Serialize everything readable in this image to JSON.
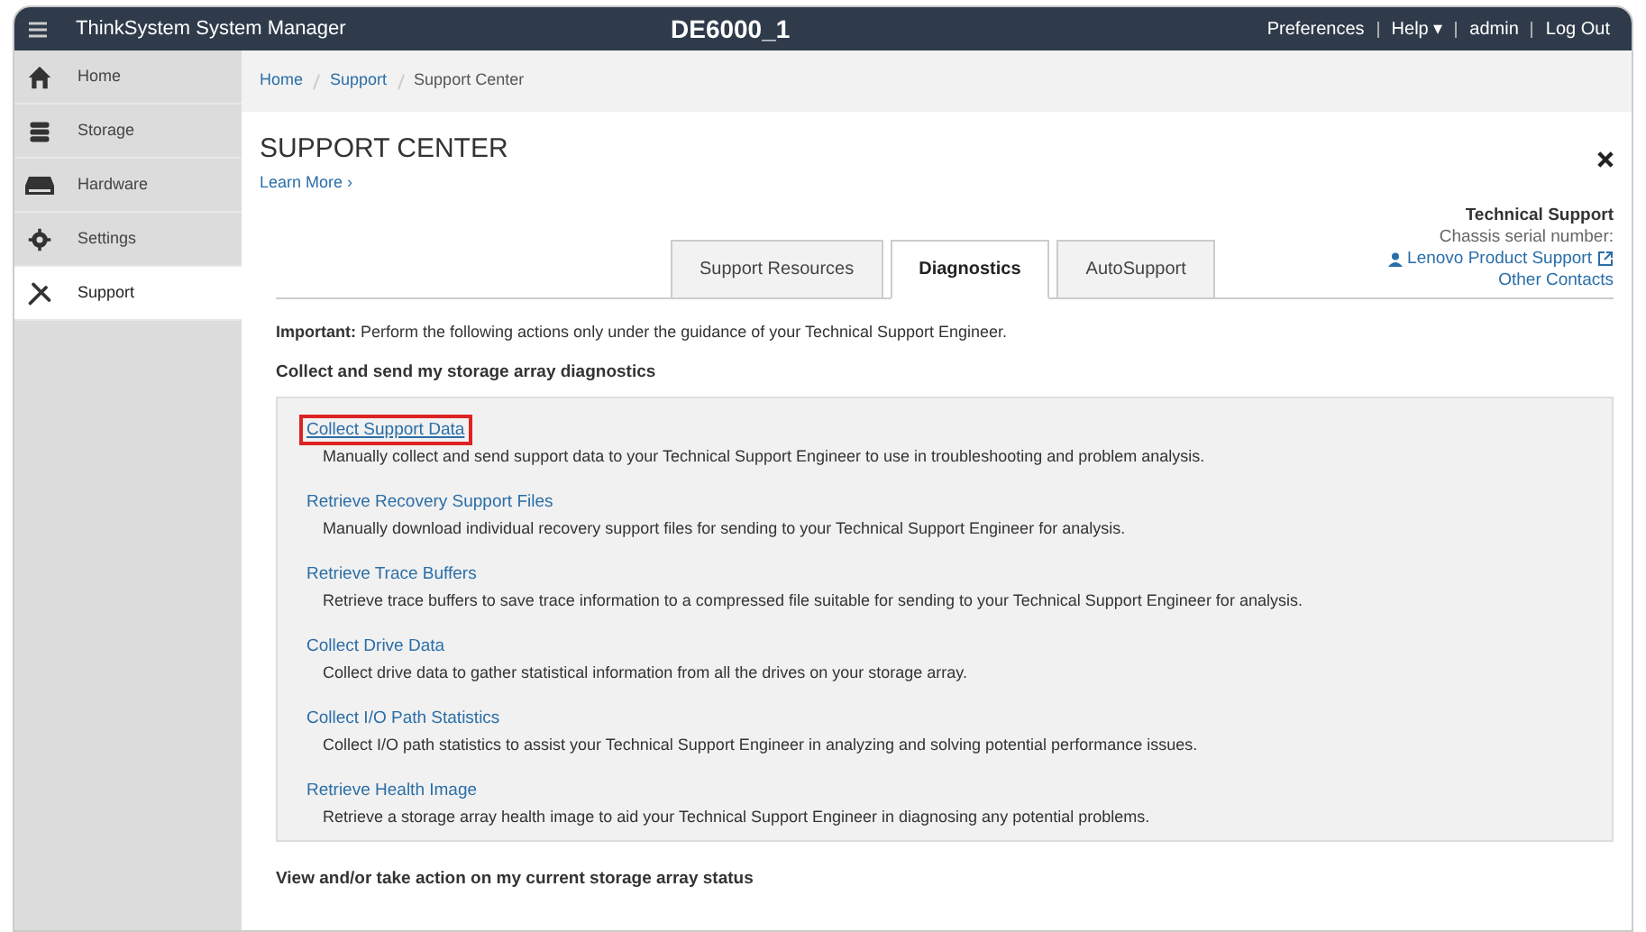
{
  "header": {
    "app_name": "ThinkSystem System Manager",
    "system_name": "DE6000_1",
    "links": [
      "Preferences",
      "Help ▾",
      "admin",
      "Log Out"
    ]
  },
  "sidebar": {
    "items": [
      {
        "label": "Home",
        "selected": false
      },
      {
        "label": "Storage",
        "selected": false
      },
      {
        "label": "Hardware",
        "selected": false
      },
      {
        "label": "Settings",
        "selected": false
      },
      {
        "label": "Support",
        "selected": true
      }
    ]
  },
  "breadcrumb": [
    "Home",
    "Support",
    "Support Center"
  ],
  "page": {
    "title": "SUPPORT CENTER",
    "learn_more": "Learn More ›"
  },
  "technical_support": {
    "heading": "Technical Support",
    "serial_label": "Chassis serial number:",
    "links": [
      "Lenovo Product Support",
      "Other Contacts"
    ]
  },
  "tabs": [
    {
      "label": "Support Resources",
      "selected": false
    },
    {
      "label": "Diagnostics",
      "selected": true
    },
    {
      "label": "AutoSupport",
      "selected": false
    }
  ],
  "important": "**Important:** Perform the following actions only under the guidance of your Technical Support Engineer.",
  "section_heading": "Collect and send my storage array diagnostics",
  "actions": [
    {
      "title": "Collect Support Data",
      "description": "Manually collect and send support data to your Technical Support Engineer to use in troubleshooting and problem analysis.",
      "highlighted": true
    },
    {
      "title": "Retrieve Recovery Support Files",
      "description": "Manually download individual recovery support files for sending to your Technical Support Engineer for analysis.",
      "highlighted": false
    },
    {
      "title": "Retrieve Trace Buffers",
      "description": "Retrieve trace buffers to save trace information to a compressed file suitable for sending to your Technical Support Engineer for analysis.",
      "highlighted": false
    },
    {
      "title": "Collect Drive Data",
      "description": "Collect drive data to gather statistical information from all the drives on your storage array.",
      "highlighted": false
    },
    {
      "title": "Collect I/O Path Statistics",
      "description": "Collect I/O path statistics to assist your Technical Support Engineer in analyzing and solving potential performance issues.",
      "highlighted": false
    },
    {
      "title": "Retrieve Health Image",
      "description": "Retrieve a storage array health image to aid your Technical Support Engineer in diagnosing any potential problems.",
      "highlighted": false
    }
  ],
  "section_heading_2": "View and/or take action on my current storage array status"
}
